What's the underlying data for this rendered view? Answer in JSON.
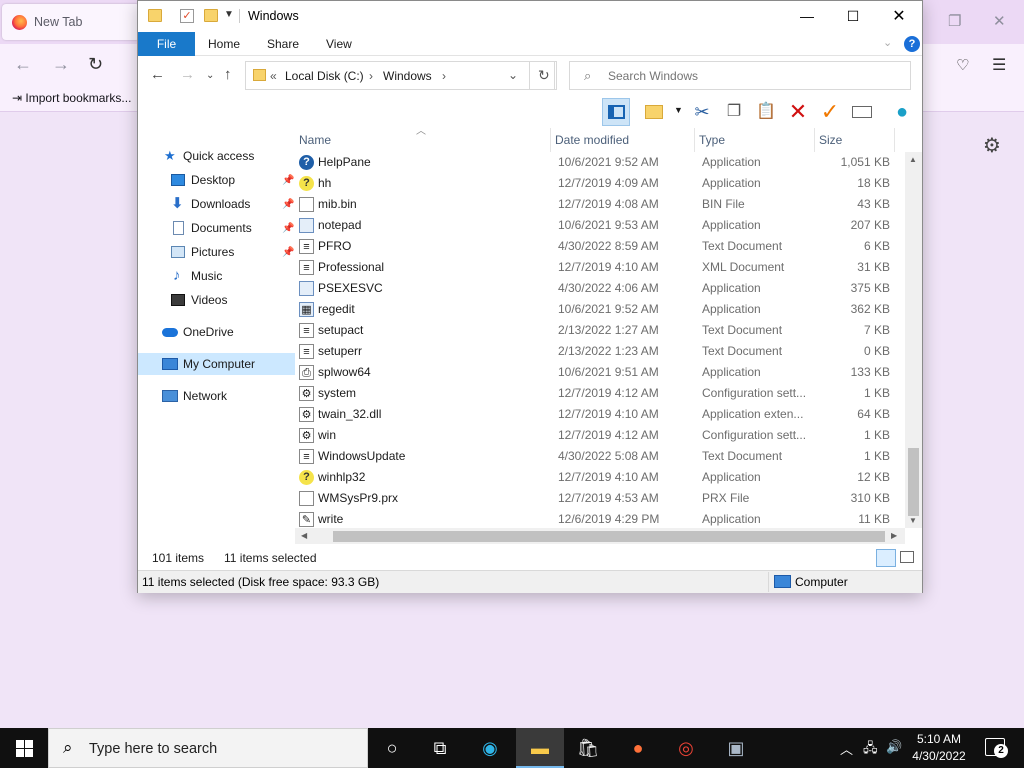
{
  "firefox": {
    "tab_label": "New Tab",
    "import_bookmarks": "Import bookmarks..."
  },
  "explorer": {
    "title": "Windows",
    "ribbon_tabs": [
      "File",
      "Home",
      "Share",
      "View"
    ],
    "breadcrumb": [
      "Local Disk (C:)",
      "Windows"
    ],
    "search_placeholder": "Search Windows",
    "nav": {
      "quick_access": "Quick access",
      "desktop": "Desktop",
      "downloads": "Downloads",
      "documents": "Documents",
      "pictures": "Pictures",
      "music": "Music",
      "videos": "Videos",
      "onedrive": "OneDrive",
      "my_computer": "My Computer",
      "network": "Network"
    },
    "columns": {
      "name": "Name",
      "date": "Date modified",
      "type": "Type",
      "size": "Size"
    },
    "files": [
      {
        "name": "HelpPane",
        "date": "10/6/2021 9:52 AM",
        "type": "Application",
        "size": "1,051 KB",
        "icon": "help-icon"
      },
      {
        "name": "hh",
        "date": "12/7/2019 4:09 AM",
        "type": "Application",
        "size": "18 KB",
        "icon": "help-question-icon"
      },
      {
        "name": "mib.bin",
        "date": "12/7/2019 4:08 AM",
        "type": "BIN File",
        "size": "43 KB",
        "icon": "file-icon"
      },
      {
        "name": "notepad",
        "date": "10/6/2021 9:53 AM",
        "type": "Application",
        "size": "207 KB",
        "icon": "notepad-icon"
      },
      {
        "name": "PFRO",
        "date": "4/30/2022 8:59 AM",
        "type": "Text Document",
        "size": "6 KB",
        "icon": "text-file-icon"
      },
      {
        "name": "Professional",
        "date": "12/7/2019 4:10 AM",
        "type": "XML Document",
        "size": "31 KB",
        "icon": "xml-file-icon"
      },
      {
        "name": "PSEXESVC",
        "date": "4/30/2022 4:06 AM",
        "type": "Application",
        "size": "375 KB",
        "icon": "app-icon"
      },
      {
        "name": "regedit",
        "date": "10/6/2021 9:52 AM",
        "type": "Application",
        "size": "362 KB",
        "icon": "regedit-icon"
      },
      {
        "name": "setupact",
        "date": "2/13/2022 1:27 AM",
        "type": "Text Document",
        "size": "7 KB",
        "icon": "text-file-icon"
      },
      {
        "name": "setuperr",
        "date": "2/13/2022 1:23 AM",
        "type": "Text Document",
        "size": "0 KB",
        "icon": "text-file-icon"
      },
      {
        "name": "splwow64",
        "date": "10/6/2021 9:51 AM",
        "type": "Application",
        "size": "133 KB",
        "icon": "printer-icon"
      },
      {
        "name": "system",
        "date": "12/7/2019 4:12 AM",
        "type": "Configuration sett...",
        "size": "1 KB",
        "icon": "config-file-icon"
      },
      {
        "name": "twain_32.dll",
        "date": "12/7/2019 4:10 AM",
        "type": "Application exten...",
        "size": "64 KB",
        "icon": "dll-file-icon"
      },
      {
        "name": "win",
        "date": "12/7/2019 4:12 AM",
        "type": "Configuration sett...",
        "size": "1 KB",
        "icon": "config-file-icon"
      },
      {
        "name": "WindowsUpdate",
        "date": "4/30/2022 5:08 AM",
        "type": "Text Document",
        "size": "1 KB",
        "icon": "text-file-icon"
      },
      {
        "name": "winhlp32",
        "date": "12/7/2019 4:10 AM",
        "type": "Application",
        "size": "12 KB",
        "icon": "help-question-icon"
      },
      {
        "name": "WMSysPr9.prx",
        "date": "12/7/2019 4:53 AM",
        "type": "PRX File",
        "size": "310 KB",
        "icon": "file-icon"
      },
      {
        "name": "write",
        "date": "12/6/2019 4:29 PM",
        "type": "Application",
        "size": "11 KB",
        "icon": "write-icon"
      }
    ],
    "info_count": "101 items",
    "info_selected": "11 items selected",
    "status_text": "11 items selected (Disk free space: 93.3 GB)",
    "status_location": "Computer"
  },
  "taskbar": {
    "search_placeholder": "Type here to search",
    "time": "5:10 AM",
    "date": "4/30/2022",
    "notification_count": "2"
  }
}
